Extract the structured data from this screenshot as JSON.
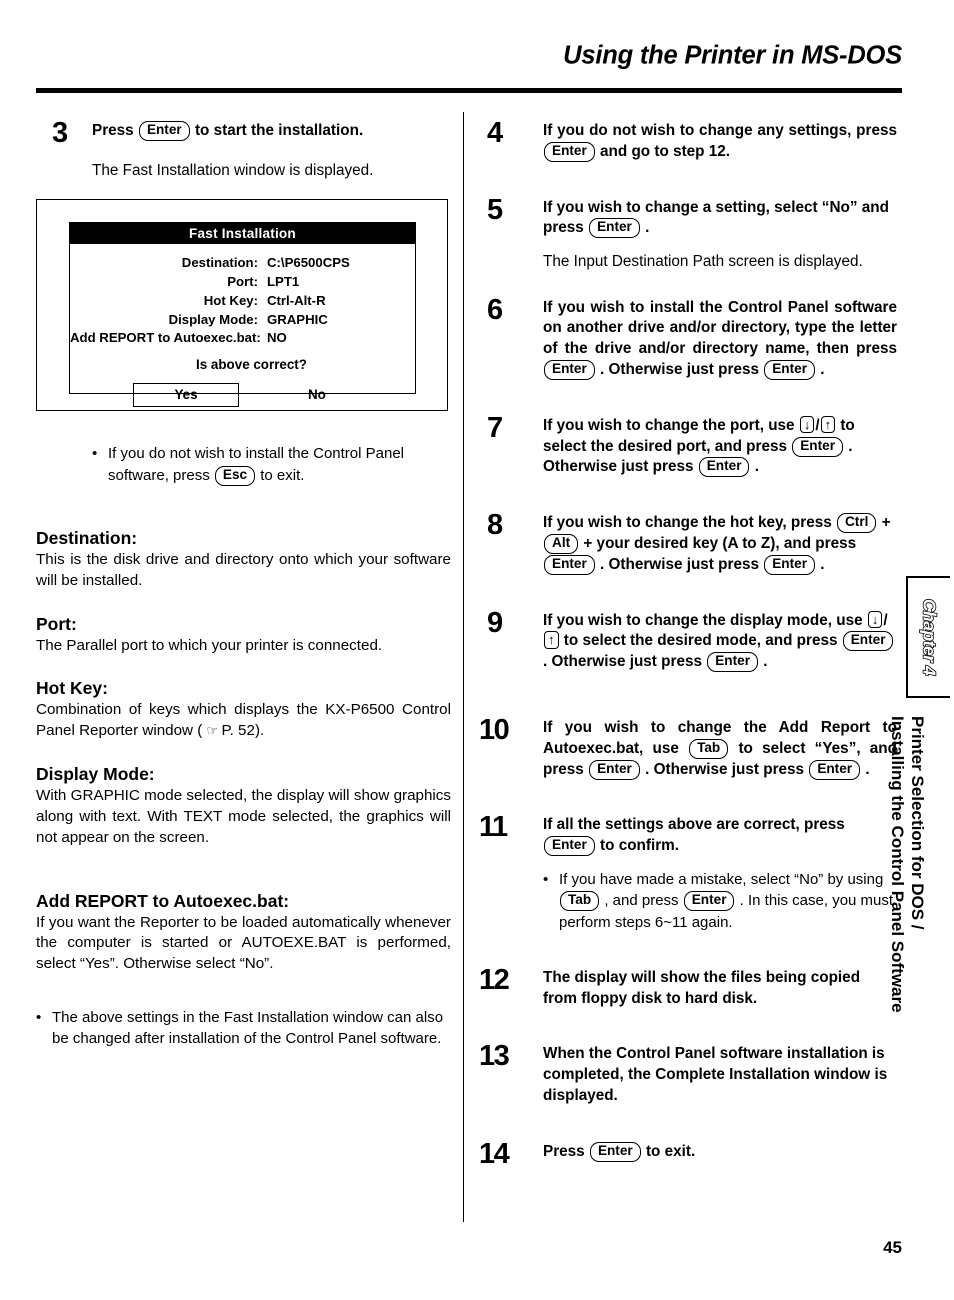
{
  "header": {
    "title": "Using the Printer in MS-DOS"
  },
  "page_number": "45",
  "side_tab": {
    "chapter_label": "Chapter 4",
    "chapter_line1": "Printer Selection for DOS /",
    "chapter_line2": "Installing the Control Panel Software"
  },
  "left_column": {
    "step3": {
      "number": "3",
      "text_before": "Press",
      "key": "Enter",
      "text_after": "to start the installation.",
      "note": "The Fast Installation window is displayed."
    },
    "fast_install_window": {
      "title": "Fast Installation",
      "fields": [
        {
          "label": "Destination:",
          "value": "C:\\P6500CPS"
        },
        {
          "label": "Port:",
          "value": "LPT1"
        },
        {
          "label": "Hot Key:",
          "value": "Ctrl-Alt-R"
        },
        {
          "label": "Display Mode:",
          "value": "GRAPHIC"
        },
        {
          "label": "Add REPORT to Autoexec.bat:",
          "value": "NO"
        }
      ],
      "question": "Is above correct?",
      "button_yes": "Yes",
      "button_no": "No"
    },
    "bullet_esc": {
      "text_before": "If you do not wish to install the Control Panel software, press",
      "key": "Esc",
      "text_after": "to exit."
    },
    "sections": [
      {
        "heading": "Destination:",
        "body": "This is the disk drive and directory onto which your software will be installed."
      },
      {
        "heading": "Port:",
        "body": "The Parallel port to which your printer is connected."
      },
      {
        "heading": "Hot Key:",
        "body_before": "Combination of keys which displays the KX-P6500 Control Panel Reporter window (",
        "hand_icon": "☞",
        "body_after": "P. 52).",
        "icon_name": "pointing-hand-icon"
      },
      {
        "heading": "Display Mode:",
        "body": "With GRAPHIC mode selected, the display will show graphics along with text. With TEXT mode selected, the graphics will not appear on the screen."
      },
      {
        "heading": "Add REPORT to Autoexec.bat:",
        "body": "If you want the Reporter to be loaded automatically whenever the computer is started or AUTOEXE.BAT is performed, select “Yes”. Otherwise select “No”."
      }
    ],
    "bullet_settings": "The above settings in the Fast Installation window can also be changed after installation of the Control Panel software."
  },
  "right_column": {
    "step4": {
      "number": "4",
      "part1": "If you do not wish to change any settings, press",
      "key1": "Enter",
      "part2": "and go to step 12."
    },
    "step5": {
      "number": "5",
      "part1": "If you wish to change a setting, select “No” and press",
      "key1": "Enter",
      "part2": ".",
      "note": "The Input Destination Path screen is displayed."
    },
    "step6": {
      "number": "6",
      "part1": "If you wish to install the Control Panel software on another drive and/or directory, type the letter of the drive and/or directory name, then press",
      "key1": "Enter",
      "part2": ". Otherwise just press",
      "key2": "Enter",
      "part3": "."
    },
    "step7": {
      "number": "7",
      "part1": "If you wish to change the port, use",
      "key_down": "↓",
      "sep": "/",
      "key_up": "↑",
      "part2": "to select the desired port, and press",
      "key1": "Enter",
      "part3": ". Otherwise just press",
      "key2": "Enter",
      "part4": "."
    },
    "step8": {
      "number": "8",
      "part1": "If you wish to change the hot key, press",
      "key_ctrl": "Ctrl",
      "plus1": "+",
      "key_alt": "Alt",
      "part2": "+ your desired key (A to Z), and press",
      "key1": "Enter",
      "part3": ". Otherwise just press",
      "key2": "Enter",
      "part4": "."
    },
    "step9": {
      "number": "9",
      "part1": "If you wish to change the display mode, use",
      "key_down": "↓",
      "sep": "/",
      "key_up": "↑",
      "part2": "to select the desired mode, and press",
      "key1": "Enter",
      "part3": ". Otherwise just press",
      "key2": "Enter",
      "part4": "."
    },
    "step10": {
      "number": "10",
      "part1": "If you wish to change the Add Report to Autoexec.bat, use",
      "key_tab": "Tab",
      "part2": "to select “Yes”, and press",
      "key1": "Enter",
      "part3": ". Otherwise just press",
      "key2": "Enter",
      "part4": "."
    },
    "step11": {
      "number": "11",
      "part1": "If all the settings above are correct, press",
      "key1": "Enter",
      "part2": "to confirm.",
      "bullet": {
        "part1": "If you have made a mistake, select “No” by using",
        "key_tab": "Tab",
        "part2": ", and press",
        "key1": "Enter",
        "part3": ". In this case, you must perform steps 6~11 again."
      }
    },
    "step12": {
      "number": "12",
      "text": "The display will show the files being copied from floppy disk to hard disk."
    },
    "step13": {
      "number": "13",
      "text": "When the Control Panel software installation is completed, the Complete Installation window is displayed."
    },
    "step14": {
      "number": "14",
      "part1": "Press",
      "key1": "Enter",
      "part2": "to exit."
    }
  }
}
